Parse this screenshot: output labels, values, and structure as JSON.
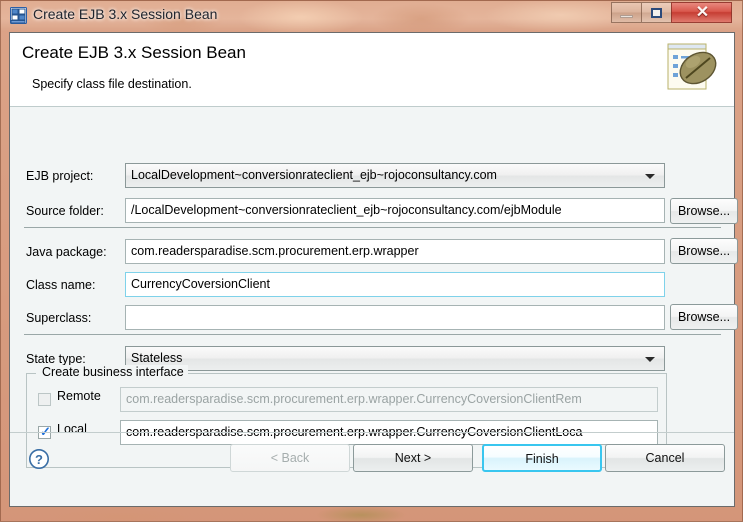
{
  "window": {
    "title": "Create EJB 3.x Session Bean",
    "icon": "ejb-bean-icon",
    "controls": {
      "minimize": "minimize-icon",
      "maximize": "maximize-icon",
      "close": "✕"
    }
  },
  "header": {
    "title": "Create EJB 3.x Session Bean",
    "subtitle": "Specify class file destination.",
    "image": "ejb-bean-banner-icon"
  },
  "form": {
    "ejb_project": {
      "label": "EJB project:",
      "value": "LocalDevelopment~conversionrateclient_ejb~rojoconsultancy.com"
    },
    "source_folder": {
      "label": "Source folder:",
      "value": "/LocalDevelopment~conversionrateclient_ejb~rojoconsultancy.com/ejbModule",
      "browse_label": "Browse..."
    },
    "java_package": {
      "label": "Java package:",
      "value": "com.readersparadise.scm.procurement.erp.wrapper",
      "browse_label": "Browse..."
    },
    "class_name": {
      "label": "Class name:",
      "value": "CurrencyCoversionClient"
    },
    "superclass": {
      "label": "Superclass:",
      "value": "",
      "browse_label": "Browse..."
    },
    "state_type": {
      "label": "State type:",
      "value": "Stateless"
    },
    "business_interface": {
      "group_label": "Create business interface",
      "remote": {
        "label": "Remote",
        "checked": false,
        "value": "com.readersparadise.scm.procurement.erp.wrapper.CurrencyCoversionClientRem"
      },
      "local": {
        "label": "Local",
        "checked": true,
        "value": "com.readersparadise.scm.procurement.erp.wrapper.CurrencyCoversionClientLoca"
      }
    }
  },
  "buttons": {
    "help": "?",
    "back": "< Back",
    "next": "Next >",
    "finish": "Finish",
    "cancel": "Cancel"
  },
  "colors": {
    "frame": "#dda68b",
    "dialog_bg": "#f2f5f5",
    "header_bg": "#ffffff",
    "default_button_border": "#39c6ef",
    "close_button": "#d9574c",
    "check_color": "#1e6fd9"
  }
}
